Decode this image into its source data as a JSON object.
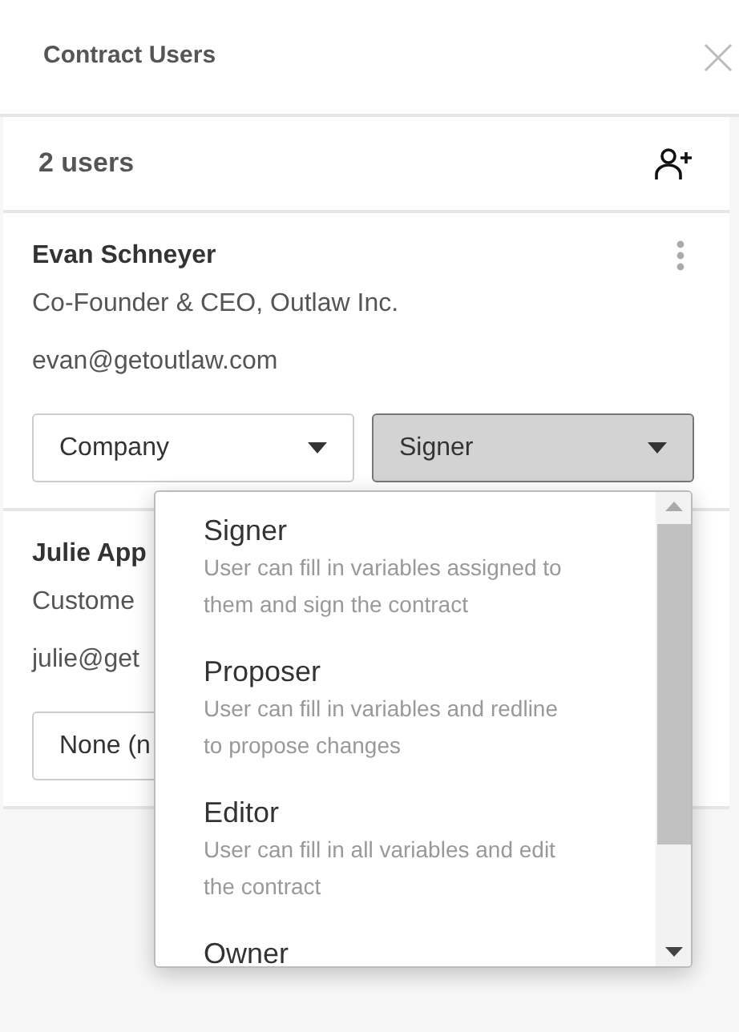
{
  "header": {
    "title": "Contract Users"
  },
  "panel": {
    "count": "2 users"
  },
  "users": [
    {
      "name": "Evan Schneyer",
      "title": "Co-Founder & CEO, Outlaw Inc.",
      "email": "evan@getoutlaw.com",
      "selects": [
        {
          "value": "Company",
          "open": false
        },
        {
          "value": "Signer",
          "open": true
        }
      ]
    },
    {
      "name": "Julie App",
      "title": "Custome",
      "email": "julie@get",
      "selects": [
        {
          "value": "None (n",
          "open": false
        }
      ]
    }
  ],
  "menu": {
    "options": [
      {
        "label": "Signer",
        "description": "User can fill in variables assigned to them and sign the contract"
      },
      {
        "label": "Proposer",
        "description": "User can fill in variables and redline to propose changes"
      },
      {
        "label": "Editor",
        "description": "User can fill in all variables and edit the contract"
      },
      {
        "label": "Owner"
      }
    ]
  }
}
